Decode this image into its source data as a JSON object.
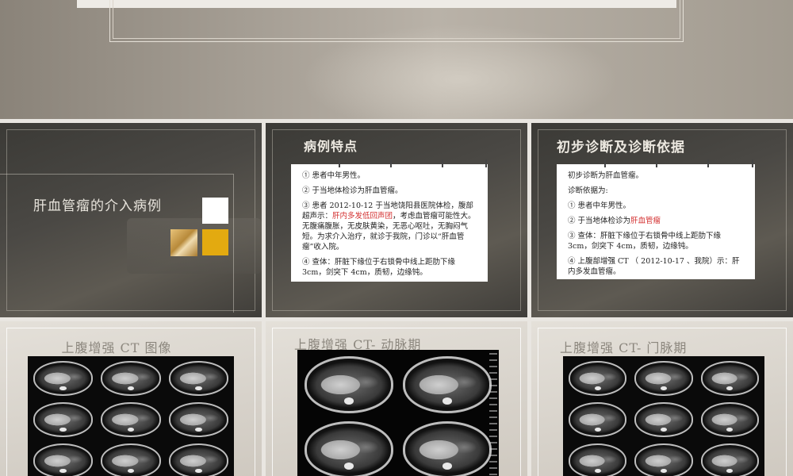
{
  "slide1": {
    "title": "肝血管瘤的介入病例"
  },
  "slide2": {
    "heading": "病例特点",
    "p1": "① 患者中年男性。",
    "p2": "② 于当地体检诊为肝血管瘤。",
    "p3_a": "③ 患者 2012-10-12 于当地饶阳县医院体检，腹部超声示：",
    "p3_red": "肝内多发低回声团",
    "p3_b": "，考虑血管瘤可能性大。无腹痛腹胀，无皮肤黄染，无恶心呕吐，无胸闷气短。为求介入治疗，就诊于我院，门诊以“肝血管瘤”收入院。",
    "p4": "④ 查体：肝脏下缘位于右锁骨中线上距肋下缘 3cm，剑突下 4cm，质韧，边缘钝。"
  },
  "slide3": {
    "heading": "初步诊断及诊断依据",
    "l1": "初步诊断为肝血管瘤。",
    "l2": "诊断依据为:",
    "l3": "① 患者中年男性。",
    "l4_a": "② 于当地体检诊为",
    "l4_red": "肝血管瘤",
    "l5": "③ 查体：肝脏下缘位于右锁骨中线上距肋下缘 3cm，剑突下 4cm，质韧，边缘钝。",
    "l6": "④ 上腹部增强 CT （ 2012-10-17 、我院）示：肝内多发血管瘤。"
  },
  "slide4": {
    "title": "上腹增强 CT 图像"
  },
  "slide5": {
    "title": "上腹增强 CT- 动脉期"
  },
  "slide6": {
    "title": "上腹增强 CT- 门脉期"
  },
  "colors": {
    "accent_red": "#d32f2f",
    "gold": "#e3aa10",
    "dark_bg": "#45433f"
  }
}
